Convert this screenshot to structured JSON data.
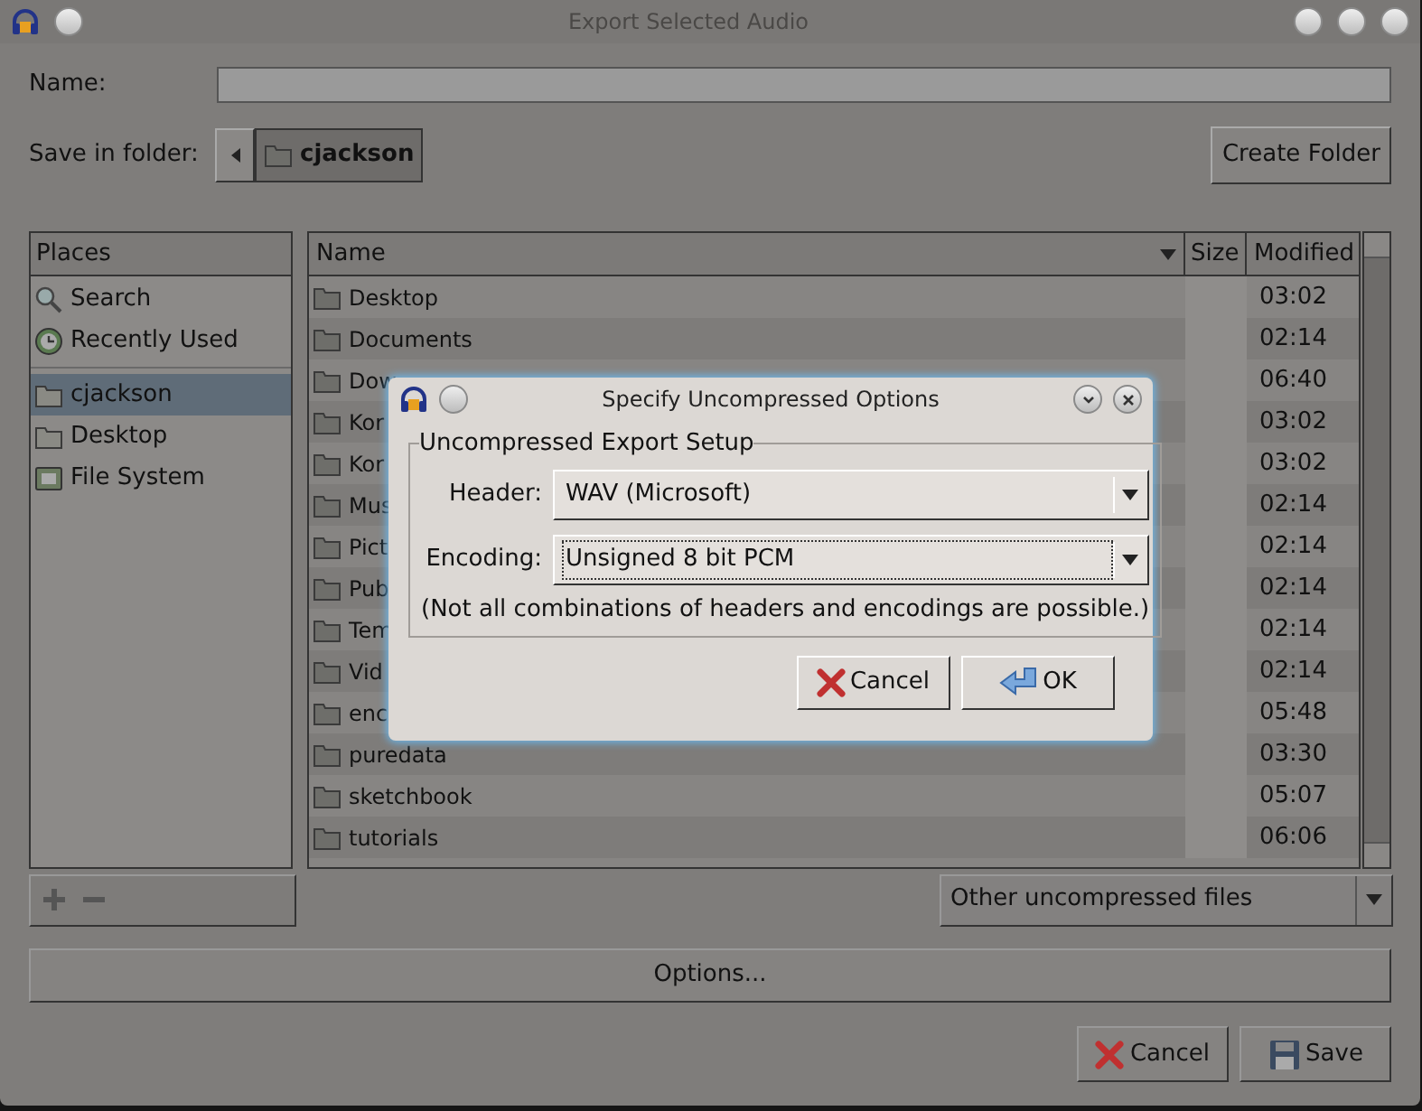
{
  "window": {
    "title": "Export Selected Audio"
  },
  "name_field": {
    "label": "Name:"
  },
  "folder_bar": {
    "label": "Save in folder:",
    "path": [
      {
        "label": "cjackson",
        "selected": true
      }
    ]
  },
  "create_folder_button": "Create Folder",
  "places": {
    "header": "Places",
    "items": [
      {
        "label": "Search",
        "kind": "search",
        "selected": false
      },
      {
        "label": "Recently Used",
        "kind": "recent",
        "selected": false
      },
      {
        "label": "cjackson",
        "kind": "folder",
        "selected": true
      },
      {
        "label": "Desktop",
        "kind": "folder",
        "selected": false
      },
      {
        "label": "File System",
        "kind": "drive",
        "selected": false
      }
    ]
  },
  "files": {
    "columns": [
      "Name",
      "Size",
      "Modified"
    ],
    "rows": [
      {
        "name": "Desktop",
        "modified": "03:02"
      },
      {
        "name": "Documents",
        "modified": "02:14"
      },
      {
        "name": "Dow",
        "modified": "06:40"
      },
      {
        "name": "Kor",
        "modified": "03:02"
      },
      {
        "name": "Kor",
        "modified": "03:02"
      },
      {
        "name": "Mus",
        "modified": "02:14"
      },
      {
        "name": "Pict",
        "modified": "02:14"
      },
      {
        "name": "Pub",
        "modified": "02:14"
      },
      {
        "name": "Tem",
        "modified": "02:14"
      },
      {
        "name": "Vid",
        "modified": "02:14"
      },
      {
        "name": "enc",
        "modified": "05:48"
      },
      {
        "name": "puredata",
        "modified": "03:30"
      },
      {
        "name": "sketchbook",
        "modified": "05:07"
      },
      {
        "name": "tutorials",
        "modified": "06:06"
      }
    ]
  },
  "filter": {
    "value": "Other uncompressed files"
  },
  "options_button": "Options...",
  "buttons": [
    {
      "label": "Cancel",
      "kind": "cancel"
    },
    {
      "label": "Save",
      "kind": "save"
    }
  ],
  "dialog": {
    "title": "Specify Uncompressed Options",
    "group_title": "Uncompressed Export Setup",
    "fields": [
      {
        "label": "Header:",
        "value": "WAV (Microsoft)",
        "focused": false
      },
      {
        "label": "Encoding:",
        "value": "Unsigned 8 bit PCM",
        "focused": true
      }
    ],
    "note": "(Not all combinations of headers and encodings are possible.)",
    "buttons": [
      {
        "label": "Cancel",
        "kind": "cancel"
      },
      {
        "label": "OK",
        "kind": "ok"
      }
    ]
  }
}
